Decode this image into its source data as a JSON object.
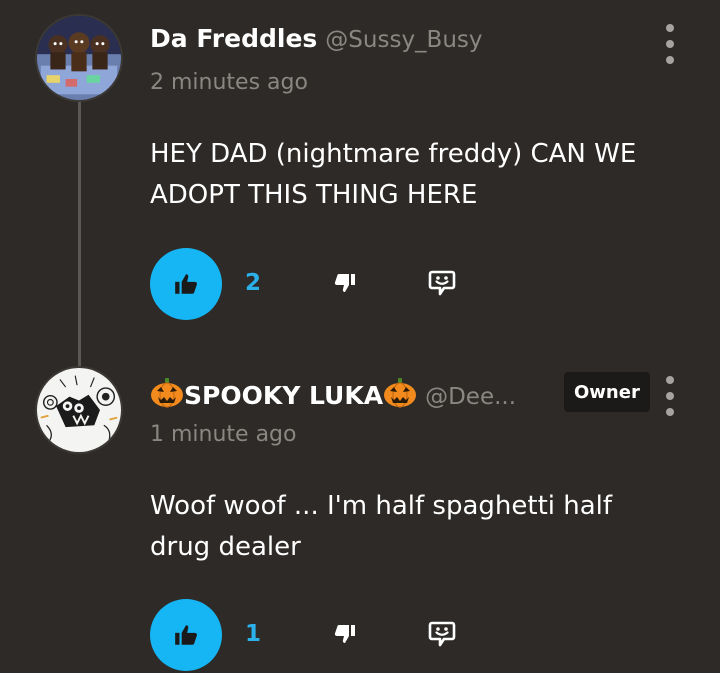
{
  "comments": [
    {
      "display_name": "Da Freddles",
      "handle": "@Sussy_Busy",
      "timestamp": "2 minutes ago",
      "body_lines": [
        "HEY DAD (nightmare freddy) CAN WE",
        "ADOPT THIS THING HERE"
      ],
      "like_count": "2",
      "avatar_icon": "fnaf-animatronics-avatar",
      "badge": null
    },
    {
      "display_name": "SPOOKY LUKA",
      "handle": "@Dee...",
      "timestamp": "1 minute ago",
      "body_lines": [
        "Woof woof ... I'm half spaghetti half",
        "drug dealer"
      ],
      "like_count": "1",
      "avatar_icon": "sketch-monster-avatar",
      "badge": "Owner",
      "name_emoji": "jack-o-lantern-icon"
    }
  ],
  "icons": {
    "like": "thumbs-up-icon",
    "dislike": "thumbs-down-icon",
    "reply": "reply-bubble-icon",
    "menu": "kebab-menu-icon"
  },
  "colors": {
    "background": "#2d2a27",
    "accent": "#16b6f5",
    "muted_text": "#8a8682",
    "badge_bg": "#1c1a18"
  }
}
